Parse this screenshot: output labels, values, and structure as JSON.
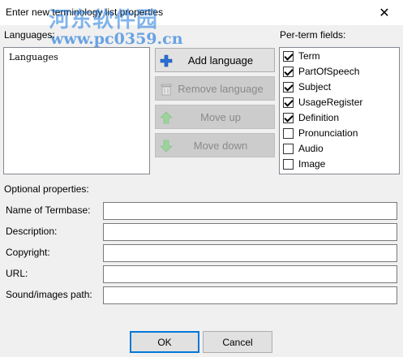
{
  "window": {
    "title": "Enter new terminology list properties",
    "close_glyph": "✕"
  },
  "watermark": {
    "line1": "河东软件园",
    "line2": "www.pc0359.cn"
  },
  "languages": {
    "label": "Languages:",
    "items": [
      "Languages"
    ]
  },
  "buttons": {
    "add_language": {
      "label": "Add language",
      "icon": "plus-icon",
      "enabled": true
    },
    "remove_language": {
      "label": "Remove language",
      "icon": "trash-icon",
      "enabled": false
    },
    "move_up": {
      "label": "Move up",
      "icon": "arrow-up-icon",
      "enabled": false
    },
    "move_down": {
      "label": "Move down",
      "icon": "arrow-down-icon",
      "enabled": false
    }
  },
  "per_term": {
    "label": "Per-term fields:",
    "fields": [
      {
        "label": "Term",
        "checked": true
      },
      {
        "label": "PartOfSpeech",
        "checked": true
      },
      {
        "label": "Subject",
        "checked": true
      },
      {
        "label": "UsageRegister",
        "checked": true
      },
      {
        "label": "Definition",
        "checked": true
      },
      {
        "label": "Pronunciation",
        "checked": false
      },
      {
        "label": "Audio",
        "checked": false
      },
      {
        "label": "Image",
        "checked": false
      }
    ]
  },
  "optional": {
    "label": "Optional properties:",
    "fields": [
      {
        "label": "Name of Termbase:",
        "value": ""
      },
      {
        "label": "Description:",
        "value": ""
      },
      {
        "label": "Copyright:",
        "value": ""
      },
      {
        "label": "URL:",
        "value": ""
      },
      {
        "label": "Sound/images path:",
        "value": ""
      }
    ]
  },
  "footer": {
    "ok_label": "OK",
    "cancel_label": "Cancel"
  },
  "colors": {
    "accent": "#0078d7",
    "add_icon": "#2a6fd6",
    "arrow_disabled": "#9cd39c"
  }
}
